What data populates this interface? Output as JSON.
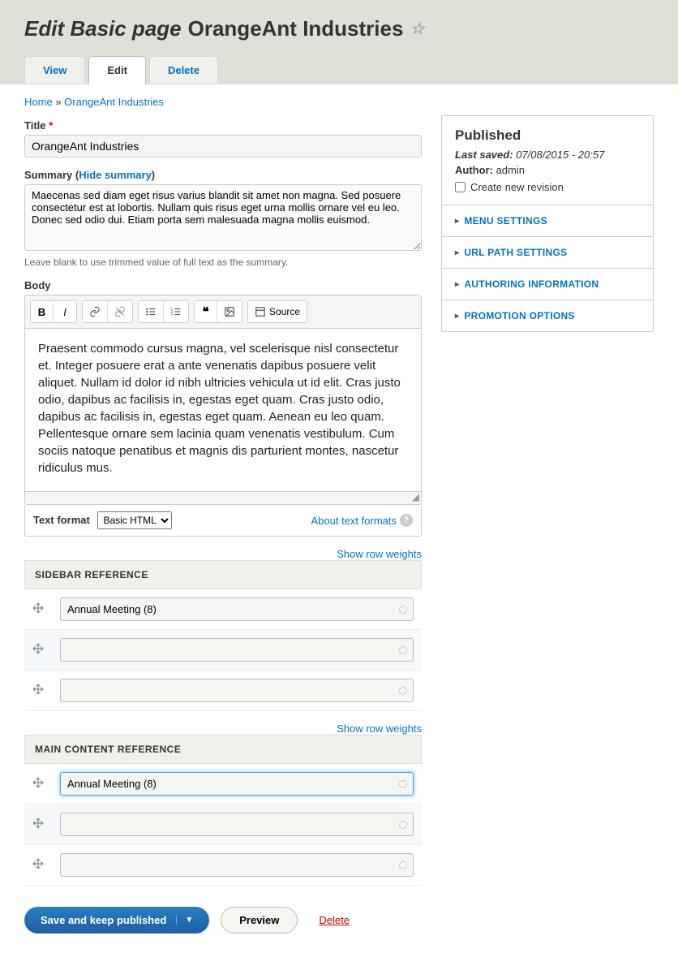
{
  "header": {
    "title_prefix": "Edit Basic page",
    "title_entity": "OrangeAnt Industries"
  },
  "tabs": {
    "view": "View",
    "edit": "Edit",
    "delete": "Delete"
  },
  "breadcrumb": {
    "home": "Home",
    "sep": "»",
    "current": "OrangeAnt Industries"
  },
  "form": {
    "title_label": "Title",
    "title_value": "OrangeAnt Industries",
    "summary_label": "Summary",
    "summary_toggle": "Hide summary",
    "summary_value": "Maecenas sed diam eget risus varius blandit sit amet non magna. Sed posuere consectetur est at lobortis. Nullam quis risus eget urna mollis ornare vel eu leo. Donec sed odio dui. Etiam porta sem malesuada magna mollis euismod.",
    "summary_desc": "Leave blank to use trimmed value of full text as the summary.",
    "body_label": "Body",
    "body_value": "Praesent commodo cursus magna, vel scelerisque nisl consectetur et. Integer posuere erat a ante venenatis dapibus posuere velit aliquet. Nullam id dolor id nibh ultricies vehicula ut id elit. Cras justo odio, dapibus ac facilisis in, egestas eget quam. Cras justo odio, dapibus ac facilisis in, egestas eget quam. Aenean eu leo quam. Pellentesque ornare sem lacinia quam venenatis vestibulum. Cum sociis natoque penatibus et magnis dis parturient montes, nascetur ridiculus mus.\n\nPraesent commodo cursus magna, vel scelerisque nisl",
    "toolbar": {
      "source": "Source"
    },
    "format_label": "Text format",
    "format_value": "Basic HTML",
    "about_formats": "About text formats",
    "row_weights": "Show row weights"
  },
  "sidebar_ref": {
    "header": "SIDEBAR REFERENCE",
    "rows": [
      "Annual Meeting (8)",
      "",
      ""
    ]
  },
  "main_ref": {
    "header": "MAIN CONTENT REFERENCE",
    "rows": [
      "Annual Meeting (8)",
      "",
      ""
    ]
  },
  "side": {
    "published": "Published",
    "last_saved_label": "Last saved:",
    "last_saved_value": "07/08/2015 - 20:57",
    "author_label": "Author:",
    "author_value": "admin",
    "revision_label": "Create new revision",
    "accordion": {
      "menu": "MENU SETTINGS",
      "url": "URL PATH SETTINGS",
      "authoring": "AUTHORING INFORMATION",
      "promotion": "PROMOTION OPTIONS"
    }
  },
  "actions": {
    "save": "Save and keep published",
    "preview": "Preview",
    "delete": "Delete"
  }
}
